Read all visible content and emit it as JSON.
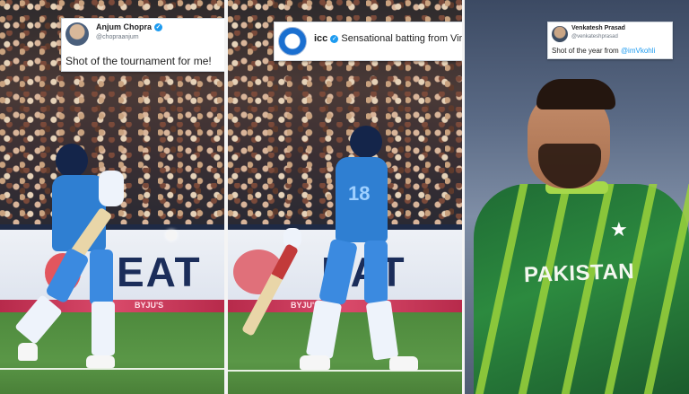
{
  "tweets": [
    {
      "name": "Anjum Chopra",
      "handle": "@chopraanjum",
      "text": "Shot of the tournament for me!",
      "verified": true
    },
    {
      "name": "icc",
      "text": "Sensational batting from Virat Kohli!",
      "emoji": "💪",
      "verified": true
    },
    {
      "name": "Venkatesh Prasad",
      "handle": "@venkateshprasad",
      "text_prefix": "Shot of the year from ",
      "mention": "@imVkohli"
    }
  ],
  "boards": {
    "panel1_text": "EAT",
    "panel2_text": "EAT",
    "strip_text": "BYJU'S"
  },
  "jersey": {
    "number": "18",
    "team_text": "PAKISTAN"
  },
  "colors": {
    "india_blue": "#2f7fd2",
    "pakistan_green": "#2c8a3f",
    "pakistan_lime": "#9bd23b",
    "twitter_blue": "#1d9bf0"
  }
}
